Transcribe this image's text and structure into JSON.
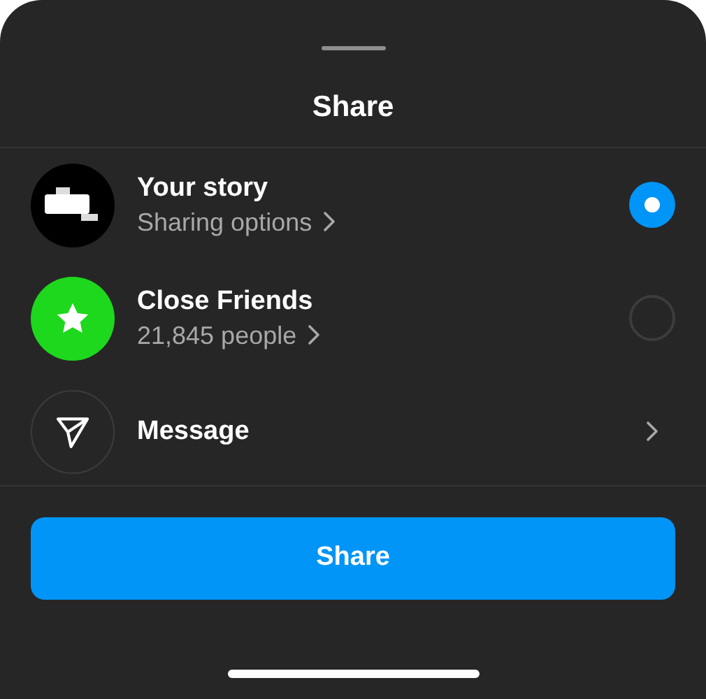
{
  "title": "Share",
  "options": [
    {
      "kind": "story",
      "name": "Your story",
      "detail": "Sharing options",
      "selected": true
    },
    {
      "kind": "friends",
      "name": "Close Friends",
      "detail": "21,845 people",
      "selected": false
    },
    {
      "kind": "message",
      "name": "Message"
    }
  ],
  "button": "Share"
}
